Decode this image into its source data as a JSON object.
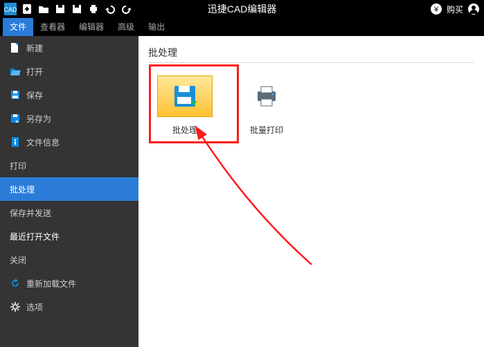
{
  "titlebar": {
    "title": "迅捷CAD编辑器",
    "buy_label": "购买"
  },
  "tabs": {
    "t0": "文件",
    "t1": "查看器",
    "t2": "编辑器",
    "t3": "高级",
    "t4": "输出"
  },
  "sidebar": {
    "i0": "新建",
    "i1": "打开",
    "i2": "保存",
    "i3": "另存为",
    "i4": "文件信息",
    "i5": "打印",
    "i6": "批处理",
    "i7": "保存并发送",
    "i8": "最近打开文件",
    "i9": "关闭",
    "i10": "重新加载文件",
    "i11": "选项"
  },
  "panel": {
    "title": "批处理",
    "card0": "批处理",
    "card1": "批量打印"
  }
}
